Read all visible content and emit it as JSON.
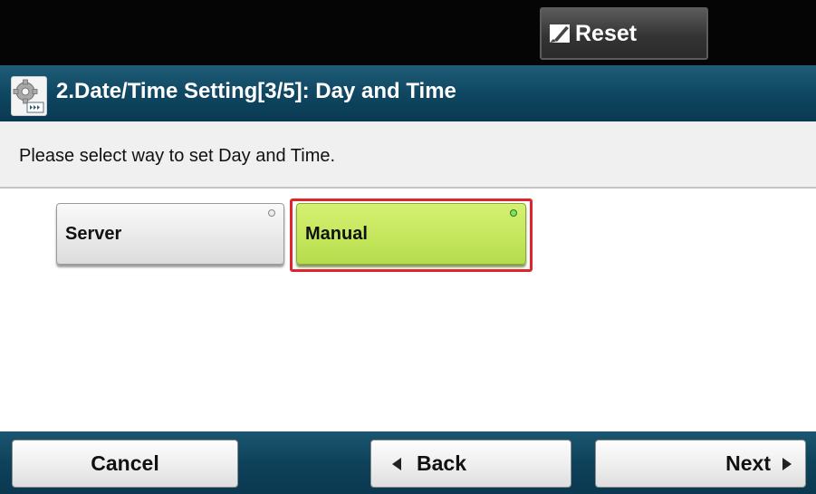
{
  "topbar": {
    "reset_label": "Reset"
  },
  "header": {
    "title": "2.Date/Time Setting[3/5]: Day and Time"
  },
  "prompt": {
    "text": "Please select way to set Day and Time."
  },
  "options": [
    {
      "label": "Server",
      "selected": false
    },
    {
      "label": "Manual",
      "selected": true
    }
  ],
  "footer": {
    "cancel_label": "Cancel",
    "back_label": "Back",
    "next_label": "Next"
  },
  "colors": {
    "selected_option": "#c3e65b",
    "selection_outline": "#e0242b",
    "titlebar": "#0e4560"
  },
  "icons": {
    "reset": "reset-icon",
    "title": "settings-gear-icon",
    "back": "left-arrow-icon",
    "next": "right-arrow-icon"
  }
}
